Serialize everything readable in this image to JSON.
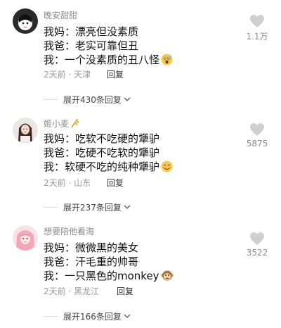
{
  "comments": [
    {
      "username": "晚安甜甜",
      "lines": [
        "我妈：漂亮但没素质",
        "我爸：老实可靠但丑",
        "我：一个没素质的丑八怪"
      ],
      "time_location": "2天前 · 天津",
      "reply_label": "回复",
      "likes": "1.1万",
      "expand_label": "展开430条回复",
      "line_emoji": "shocked-face-emoji"
    },
    {
      "username": "姬小麦",
      "username_deco": "wheat-icon",
      "lines": [
        "我妈：吃软不吃硬的犟驴",
        "我爸：吃硬不吃软的犟驴",
        "我：软硬不吃的纯种犟驴"
      ],
      "time_location": "2天前 · 山东",
      "reply_label": "回复",
      "likes": "5875",
      "expand_label": "展开237条回复",
      "line_emoji": "blushing-smile-emoji"
    },
    {
      "username": "想要陪他看海",
      "lines": [
        "我妈：微微黑的美女",
        "我爸：汗毛重的帅哥",
        "我：一只黑色的monkey"
      ],
      "time_location": "2天前 · 黑龙江",
      "reply_label": "回复",
      "likes": "3522",
      "expand_label": "展开166条回复",
      "line_emoji": "monkey-face-emoji"
    }
  ],
  "colors": {
    "text": "#111111",
    "secondary": "#8a8a8a",
    "heart": "#cfcfcf"
  }
}
